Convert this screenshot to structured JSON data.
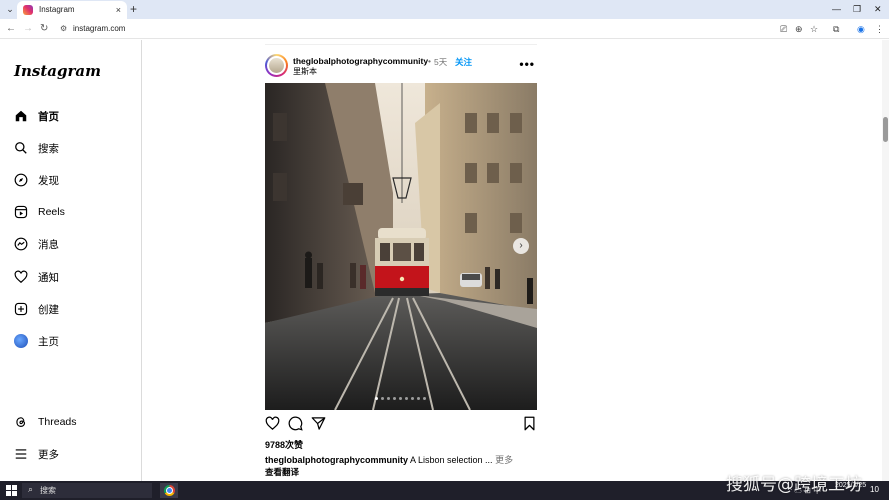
{
  "browser": {
    "tab_title": "Instagram",
    "url": "instagram.com",
    "tab_close": "×",
    "new_tab": "+",
    "win_min": "—",
    "win_restore": "❐",
    "win_close": "✕"
  },
  "sidebar": {
    "logo": "Instagram",
    "items": [
      {
        "label": "首页",
        "icon": "home-icon"
      },
      {
        "label": "搜索",
        "icon": "search-icon"
      },
      {
        "label": "发现",
        "icon": "compass-icon"
      },
      {
        "label": "Reels",
        "icon": "reels-icon"
      },
      {
        "label": "消息",
        "icon": "messenger-icon"
      },
      {
        "label": "通知",
        "icon": "heart-icon"
      },
      {
        "label": "创建",
        "icon": "plus-icon"
      },
      {
        "label": "主页",
        "icon": "profile-avatar"
      }
    ],
    "bottom_items": [
      {
        "label": "Threads",
        "icon": "threads-icon"
      },
      {
        "label": "更多",
        "icon": "menu-icon"
      }
    ]
  },
  "post": {
    "username": "theglobalphotographycommunity",
    "dot": "•",
    "time": "5天",
    "follow": "关注",
    "subtitle": "里斯本",
    "more": "•••",
    "image_count": 9,
    "active_image": 1,
    "likes": "9788次赞",
    "caption_user": "theglobalphotographycommunity",
    "caption_text": " A Lisbon selection ...",
    "caption_more": " 更多",
    "translate": "查看翻译"
  },
  "taskbar": {
    "search_placeholder": "搜索",
    "time": "",
    "date": "2025/3/25",
    "tray": "^ ☁ ⊞ 中",
    "notif": "10"
  },
  "watermark": "搜狐号@跨境工坊",
  "colors": {
    "accent": "#0095f6",
    "tabbar": "#dfe7f5",
    "taskbar": "#1f1f2a"
  }
}
